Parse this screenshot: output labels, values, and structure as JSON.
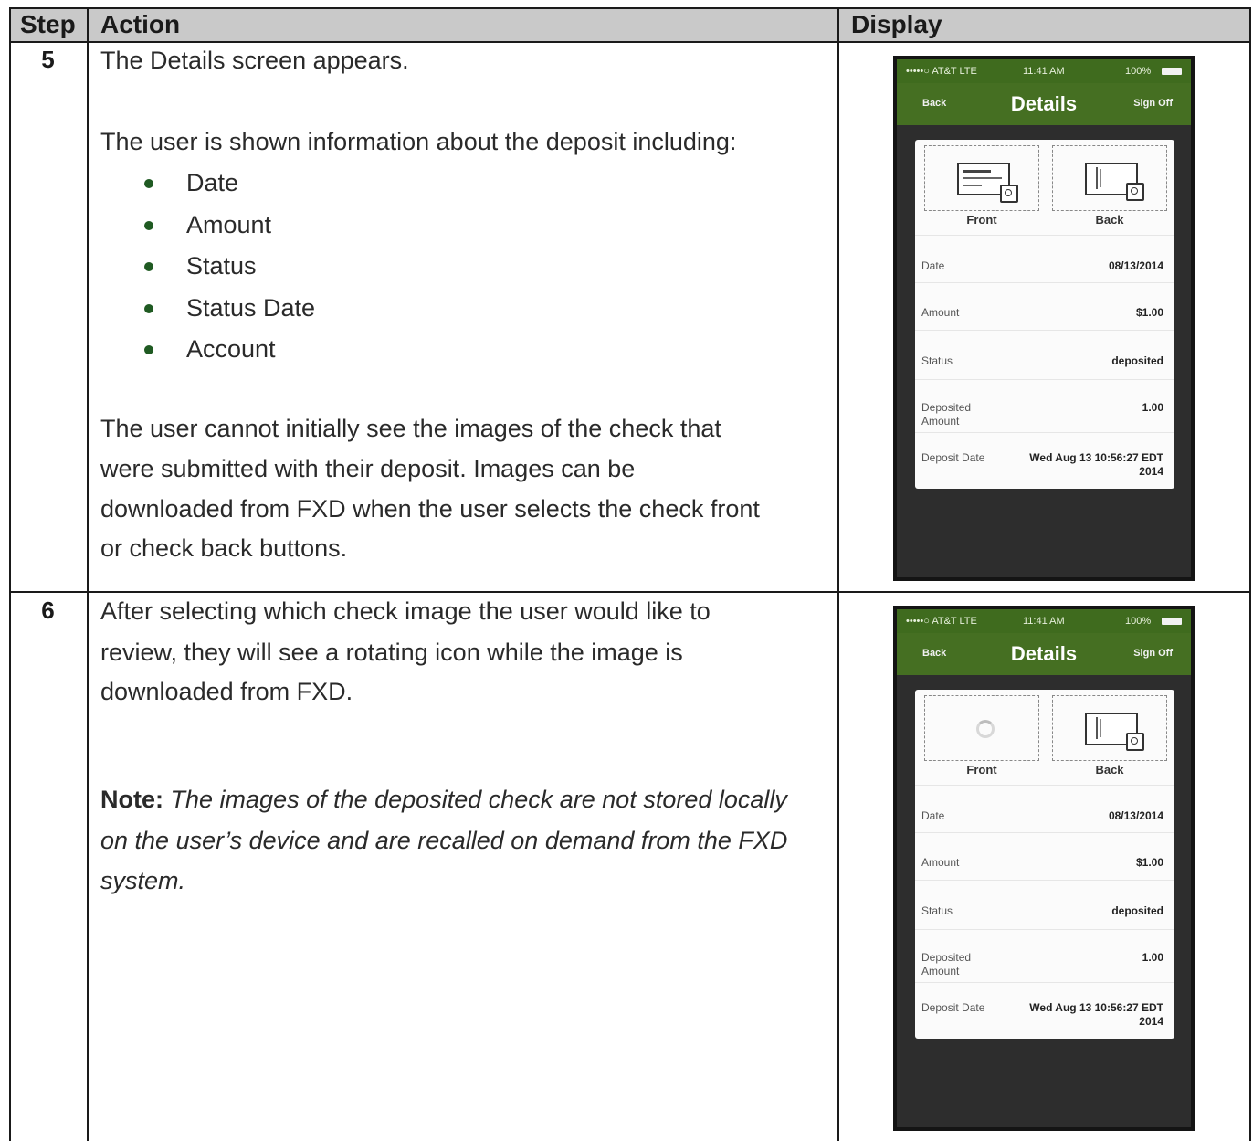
{
  "table": {
    "headers": {
      "step": "Step",
      "action": "Action",
      "display": "Display"
    }
  },
  "rows": [
    {
      "step": "5",
      "intro": "The Details screen appears.",
      "list_intro": "The user is shown information about the deposit including:",
      "bullets": [
        "Date",
        "Amount",
        "Status",
        "Status Date",
        "Account"
      ],
      "paragraph_lines": [
        "The user cannot initially see the images of the check that",
        "were submitted with their deposit.  Images can be",
        "downloaded from FXD when the user selects the check front",
        "or check back buttons."
      ]
    },
    {
      "step": "6",
      "paragraph_lines": [
        "After selecting which check image the user would like to",
        "review, they will see a rotating icon while the image is",
        "downloaded from FXD."
      ],
      "note_label": "Note:",
      "note_lines": [
        "The images of the deposited check are not stored locally",
        "on the user’s device and are recalled on demand from the FXD",
        "system."
      ]
    }
  ],
  "phone": {
    "carrier": "•••••○ AT&T  LTE",
    "time": "11:41 AM",
    "battery_text": "100%",
    "back_label": "Back",
    "title": "Details",
    "sign_off_label": "Sign Off",
    "front_label": "Front",
    "back_image_label": "Back",
    "details": [
      {
        "label": "Date",
        "value": "08/13/2014"
      },
      {
        "label": "Amount",
        "value": "$1.00"
      },
      {
        "label": "Status",
        "value": "deposited"
      },
      {
        "label": "Deposited Amount",
        "value": "1.00"
      },
      {
        "label": "Deposit Date",
        "value": "Wed Aug 13 10:56:27 EDT 2014"
      }
    ]
  }
}
